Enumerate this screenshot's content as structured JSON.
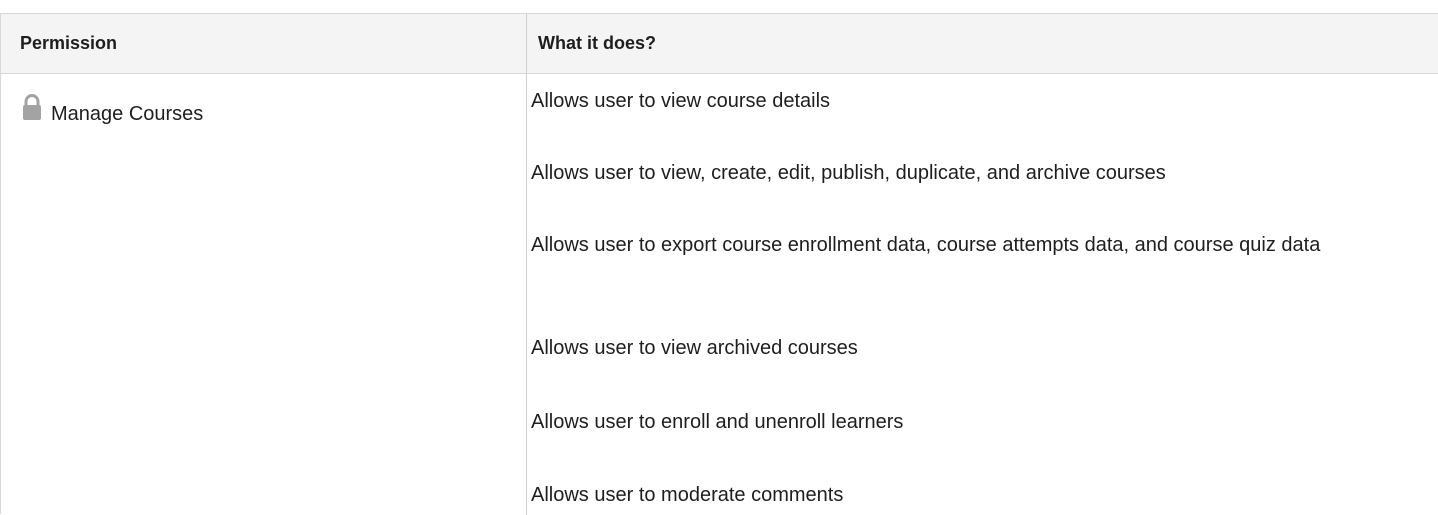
{
  "table": {
    "headers": {
      "permission": "Permission",
      "what_it_does": "What it does?"
    },
    "rows": [
      {
        "permission": {
          "icon": "lock-icon",
          "label": "Manage Courses"
        },
        "descriptions": [
          "Allows user to view course details",
          "Allows user to view, create, edit, publish, duplicate, and archive courses",
          "Allows user to export course enrollment data, course attempts data,  and course quiz data",
          "Allows user to view archived courses",
          "Allows user to enroll and unenroll learners",
          "Allows user to moderate comments"
        ]
      }
    ]
  },
  "colors": {
    "header_bg": "#f4f4f4",
    "border": "#d8d8d8",
    "text": "#1e1e1e",
    "icon": "#a3a3a3"
  }
}
